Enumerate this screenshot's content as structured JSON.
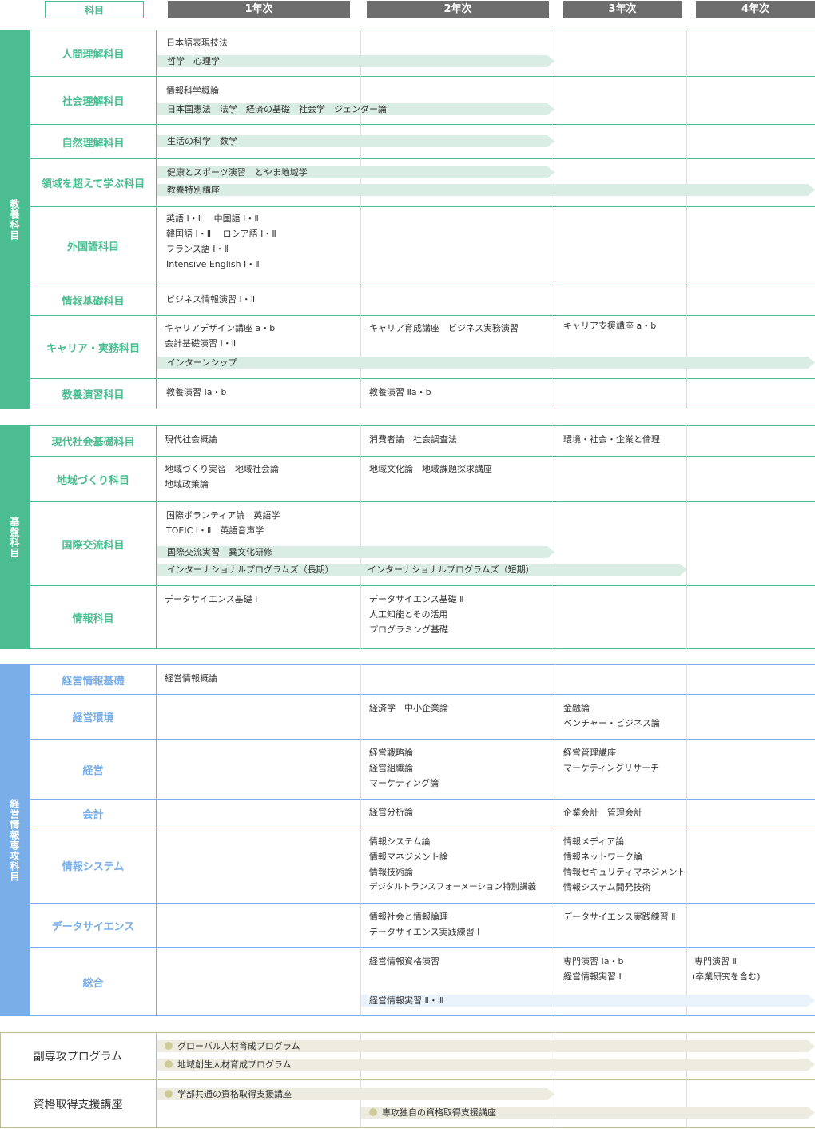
{
  "header": {
    "subject": "科目",
    "y1": "1年次",
    "y2": "2年次",
    "y3": "3年次",
    "y4": "4年次"
  },
  "sections": {
    "kyoyo": "教養科目",
    "kiban": "基盤科目",
    "senko": "経営情報専攻科目"
  },
  "kyoyo": {
    "ningen": {
      "label": "人間理解科目",
      "t1": "日本語表現技法",
      "bar": "哲学　心理学"
    },
    "shakai": {
      "label": "社会理解科目",
      "t1": "情報科学概論",
      "bar": "日本国憲法　法学　経済の基礎　社会学　ジェンダー論"
    },
    "shizen": {
      "label": "自然理解科目",
      "bar": "生活の科学　数学"
    },
    "ryoiki": {
      "label": "領域を超えて学ぶ科目",
      "bar1": "健康とスポーツ演習　とやま地域学",
      "bar2": "教養特別講座"
    },
    "gaikoku": {
      "label": "外国語科目",
      "l1": "英語 Ⅰ・Ⅱ　 中国語 Ⅰ・Ⅱ",
      "l2": "韓国語 Ⅰ・Ⅱ　 ロシア語 Ⅰ・Ⅱ",
      "l3": "フランス語 Ⅰ・Ⅱ",
      "l4": "Intensive English Ⅰ・Ⅱ"
    },
    "joho": {
      "label": "情報基礎科目",
      "t1": "ビジネス情報演習 Ⅰ・Ⅱ"
    },
    "career": {
      "label": "キャリア・実務科目",
      "y1a": "キャリアデザイン講座 a・b",
      "y1b": "会計基礎演習 Ⅰ・Ⅱ",
      "y2": "キャリア育成講座　ビジネス実務演習",
      "y3": "キャリア支援講座 a・b",
      "bar": "インターンシップ"
    },
    "ensyu": {
      "label": "教養演習科目",
      "y1": "教養演習 Ⅰa・b",
      "y2": "教養演習 Ⅱa・b"
    }
  },
  "kiban": {
    "gendai": {
      "label": "現代社会基礎科目",
      "y1": "現代社会概論",
      "y2": "消費者論　社会調査法",
      "y3": "環境・社会・企業と倫理"
    },
    "chiiki": {
      "label": "地域づくり科目",
      "y1a": "地域づくり実習　地域社会論",
      "y1b": "地域政策論",
      "y2": "地域文化論　地域課題探求講座"
    },
    "kokusai": {
      "label": "国際交流科目",
      "y1a": "国際ボランティア論　英語学",
      "y1b": "TOEIC Ⅰ・Ⅱ　英語音声学",
      "bar1": "国際交流実習　異文化研修",
      "bar2": "インターナショナルプログラムズ（長期）",
      "bar3": "インターナショナルプログラムズ（短期）"
    },
    "joho": {
      "label": "情報科目",
      "y1": "データサイエンス基礎 Ⅰ",
      "y2a": "データサイエンス基礎 Ⅱ",
      "y2b": "人工知能とその活用",
      "y2c": "プログラミング基礎"
    }
  },
  "senko": {
    "kiso": {
      "label": "経営情報基礎",
      "y1": "経営情報概論"
    },
    "kankyo": {
      "label": "経営環境",
      "y2": "経済学　中小企業論",
      "y3a": "金融論",
      "y3b": "ベンチャー・ビジネス論"
    },
    "keiei": {
      "label": "経営",
      "y2a": "経営戦略論",
      "y2b": "経営組織論",
      "y2c": "マーケティング論",
      "y3a": "経営管理講座",
      "y3b": "マーケティングリサーチ"
    },
    "kaikei": {
      "label": "会計",
      "y2": "経営分析論",
      "y3": "企業会計　管理会計"
    },
    "system": {
      "label": "情報システム",
      "y2a": "情報システム論",
      "y2b": "情報マネジメント論",
      "y2c": "情報技術論",
      "y2d": "デジタルトランスフォーメーション特別講義",
      "y3a": "情報メディア論",
      "y3b": "情報ネットワーク論",
      "y3c": "情報セキュリティマネジメント",
      "y3d": "情報システム開発技術"
    },
    "ds": {
      "label": "データサイエンス",
      "y2a": "情報社会と情報論理",
      "y2b": "データサイエンス実践練習 Ⅰ",
      "y3": "データサイエンス実践練習 Ⅱ"
    },
    "sogo": {
      "label": "総合",
      "y2": "経営情報資格演習",
      "y3a": "専門演習 Ⅰa・b",
      "y3b": "経営情報実習 Ⅰ",
      "y4a": "専門演習 Ⅱ",
      "y4b": "(卒業研究を含む)",
      "bar": "経営情報実習 Ⅱ・Ⅲ"
    }
  },
  "extra": {
    "fuku": {
      "label": "副専攻プログラム",
      "bar1": "グローバル人材育成プログラム",
      "bar2": "地域創生人材育成プログラム"
    },
    "shikaku": {
      "label": "資格取得支援講座",
      "bar1": "学部共通の資格取得支援講座",
      "bar2": "専攻独自の資格取得支援講座"
    }
  },
  "colors": {
    "green": "#4cbd91",
    "blue": "#7aaee8",
    "khaki": "#bdb99a",
    "header": "#6e6e6e"
  }
}
